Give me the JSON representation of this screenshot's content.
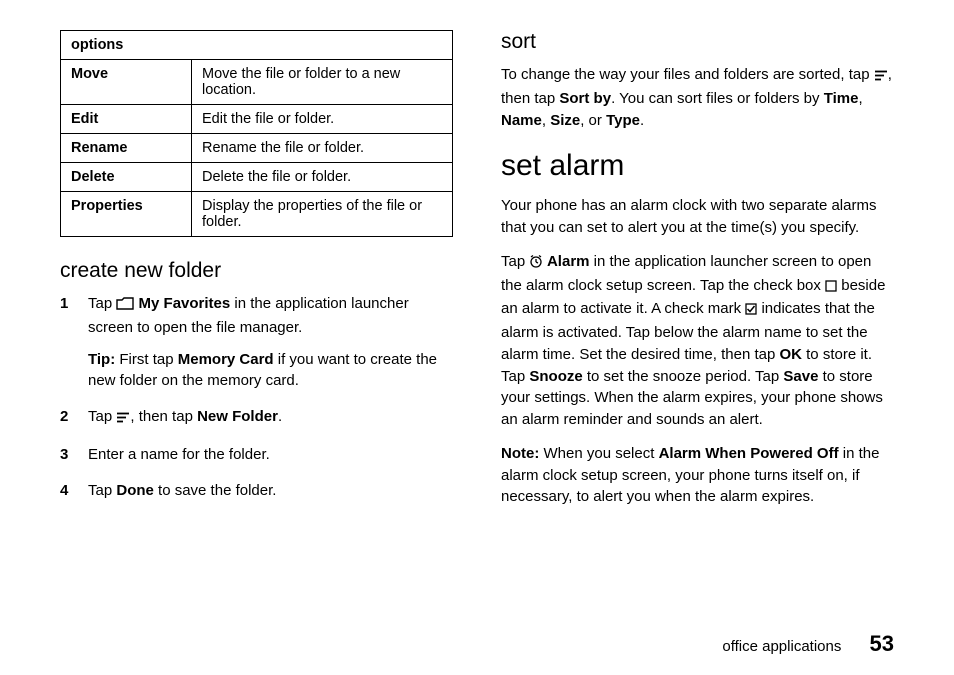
{
  "left": {
    "tableHeader": "options",
    "rows": [
      {
        "opt": "Move",
        "desc": "Move the file or folder to a new location."
      },
      {
        "opt": "Edit",
        "desc": "Edit the file or folder."
      },
      {
        "opt": "Rename",
        "desc": "Rename the file or folder."
      },
      {
        "opt": "Delete",
        "desc": "Delete the file or folder."
      },
      {
        "opt": "Properties",
        "desc": "Display the properties of the file or folder."
      }
    ],
    "createHeading": "create new folder",
    "step1_a": "Tap ",
    "step1_myfav": " My Favorites",
    "step1_b": " in the application launcher screen to open the file manager.",
    "tip_label": "Tip:",
    "tip_a": " First tap ",
    "tip_mem": "Memory Card",
    "tip_b": " if you want to create the new folder on the memory card.",
    "step2_a": "Tap ",
    "step2_b": ", then tap ",
    "step2_nf": "New Folder",
    "step2_c": ".",
    "step3": "Enter a name for the folder.",
    "step4_a": "Tap ",
    "step4_done": "Done",
    "step4_b": " to save the folder."
  },
  "right": {
    "sortHeading": "sort",
    "sort_a": "To change the way your files and folders are sorted, tap ",
    "sort_b": ", then tap ",
    "sort_sortby": "Sort by",
    "sort_c": ". You can sort files or folders by ",
    "sort_time": "Time",
    "sort_name": "Name",
    "sort_size": "Size",
    "sort_or": ", or ",
    "sort_type": "Type",
    "sort_d": ".",
    "alarmHeading": "set alarm",
    "alarm_p1": "Your phone has an alarm clock with two separate alarms that you can set to alert you at the time(s) you specify.",
    "alarm_p2_a": "Tap ",
    "alarm_lbl": " Alarm",
    "alarm_p2_b": " in the application launcher screen to open the alarm clock setup screen. Tap the check box ",
    "alarm_p2_c": " beside an alarm to activate it. A check mark ",
    "alarm_p2_d": " indicates that the alarm is activated. Tap below the alarm name to set the alarm time. Set the desired time, then tap ",
    "alarm_ok": "OK",
    "alarm_p2_e": " to store it. Tap ",
    "alarm_snooze": "Snooze",
    "alarm_p2_f": " to set the snooze period. Tap ",
    "alarm_save": "Save",
    "alarm_p2_g": " to store your settings. When the alarm expires, your phone shows an alarm reminder and sounds an alert.",
    "note_label": "Note:",
    "note_a": " When you select ",
    "note_apo": "Alarm When Powered Off",
    "note_b": " in the alarm clock setup screen, your phone turns itself on, if necessary, to alert you when the alarm expires."
  },
  "footer": {
    "section": "office applications",
    "page": "53"
  }
}
